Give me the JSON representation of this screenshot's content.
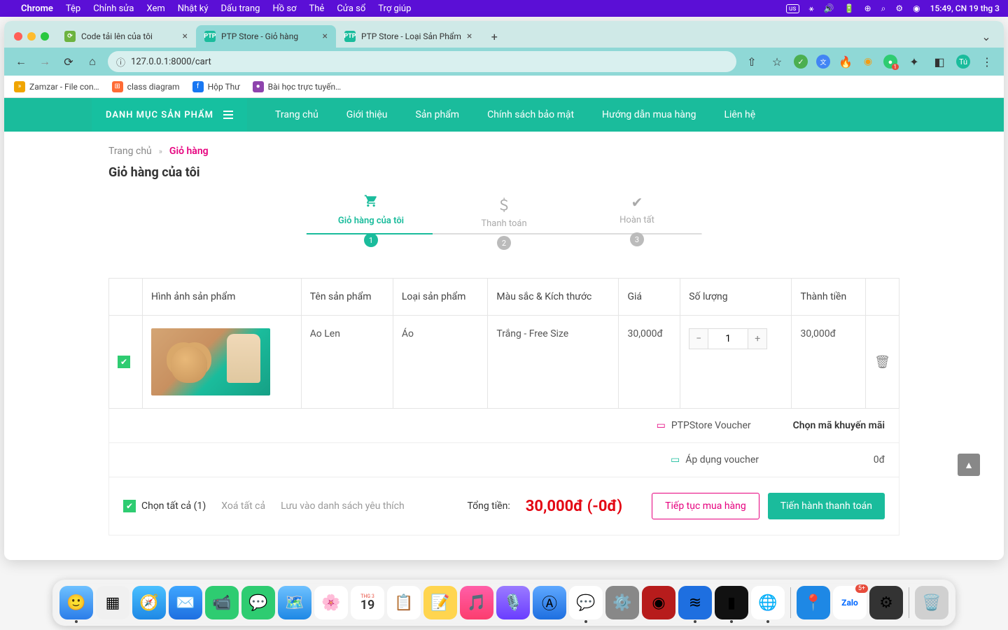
{
  "menubar": {
    "app": "Chrome",
    "items": [
      "Tệp",
      "Chỉnh sửa",
      "Xem",
      "Nhật ký",
      "Dấu trang",
      "Hồ sơ",
      "Thẻ",
      "Cửa sổ",
      "Trợ giúp"
    ],
    "input": "us",
    "clock": "15:49, CN 19 thg 3"
  },
  "tabs": [
    {
      "title": "Code tải lên của tôi",
      "favbg": "#6db33f",
      "favtxt": "⟳",
      "active": false
    },
    {
      "title": "PTP Store - Giỏ hàng",
      "favbg": "#1abc9c",
      "favtxt": "PTP",
      "active": true
    },
    {
      "title": "PTP Store - Loại Sản Phẩm",
      "favbg": "#1abc9c",
      "favtxt": "PTP",
      "active": false
    }
  ],
  "url": "127.0.0.1:8000/cart",
  "bookmarks": [
    {
      "icon": "»",
      "bg": "#f0a500",
      "label": "Zamzar - File con…"
    },
    {
      "icon": "⊞",
      "bg": "#ff6b35",
      "label": "class diagram"
    },
    {
      "icon": "f",
      "bg": "#1877f2",
      "label": "Hộp Thư"
    },
    {
      "icon": "●",
      "bg": "#8e44ad",
      "label": "Bài học trực tuyến…"
    }
  ],
  "nav": {
    "category": "DANH MỤC SẢN PHẨM",
    "links": [
      "Trang chủ",
      "Giới thiệu",
      "Sản phẩm",
      "Chính sách bảo mật",
      "Hướng dẫn mua hàng",
      "Liên hệ"
    ]
  },
  "breadcrumb": {
    "home": "Trang chủ",
    "current": "Giỏ hàng"
  },
  "pagetitle": "Giỏ hàng của tôi",
  "steps": [
    {
      "icon": "🛒",
      "label": "Giỏ hàng của tôi",
      "num": "1"
    },
    {
      "icon": "＄",
      "label": "Thanh toán",
      "num": "2"
    },
    {
      "icon": "✔",
      "label": "Hoàn tất",
      "num": "3"
    }
  ],
  "table": {
    "headers": [
      "",
      "Hình ảnh sản phẩm",
      "Tên sản phẩm",
      "Loại sản phẩm",
      "Màu sắc & Kích thước",
      "Giá",
      "Số lượng",
      "Thành tiền",
      ""
    ],
    "row": {
      "name": "Ao Len",
      "category": "Áo",
      "variant": "Trắng - Free Size",
      "price": "30,000đ",
      "qty": "1",
      "subtotal": "30,000đ"
    }
  },
  "voucher": {
    "label": "PTPStore Voucher",
    "action": "Chọn mã khuyến mãi",
    "apply": "Áp dụng voucher",
    "applied": "0đ"
  },
  "footer": {
    "selectAll": "Chọn tất cả (1)",
    "deleteAll": "Xoá tất cả",
    "saveFav": "Lưu vào danh sách yêu thích",
    "totalLabel": "Tổng tiền:",
    "totalValue": "30,000đ (-0đ)",
    "continue": "Tiếp tục mua hàng",
    "checkout": "Tiến hành thanh toán"
  },
  "extbadge": "1",
  "avatar": "Tú"
}
